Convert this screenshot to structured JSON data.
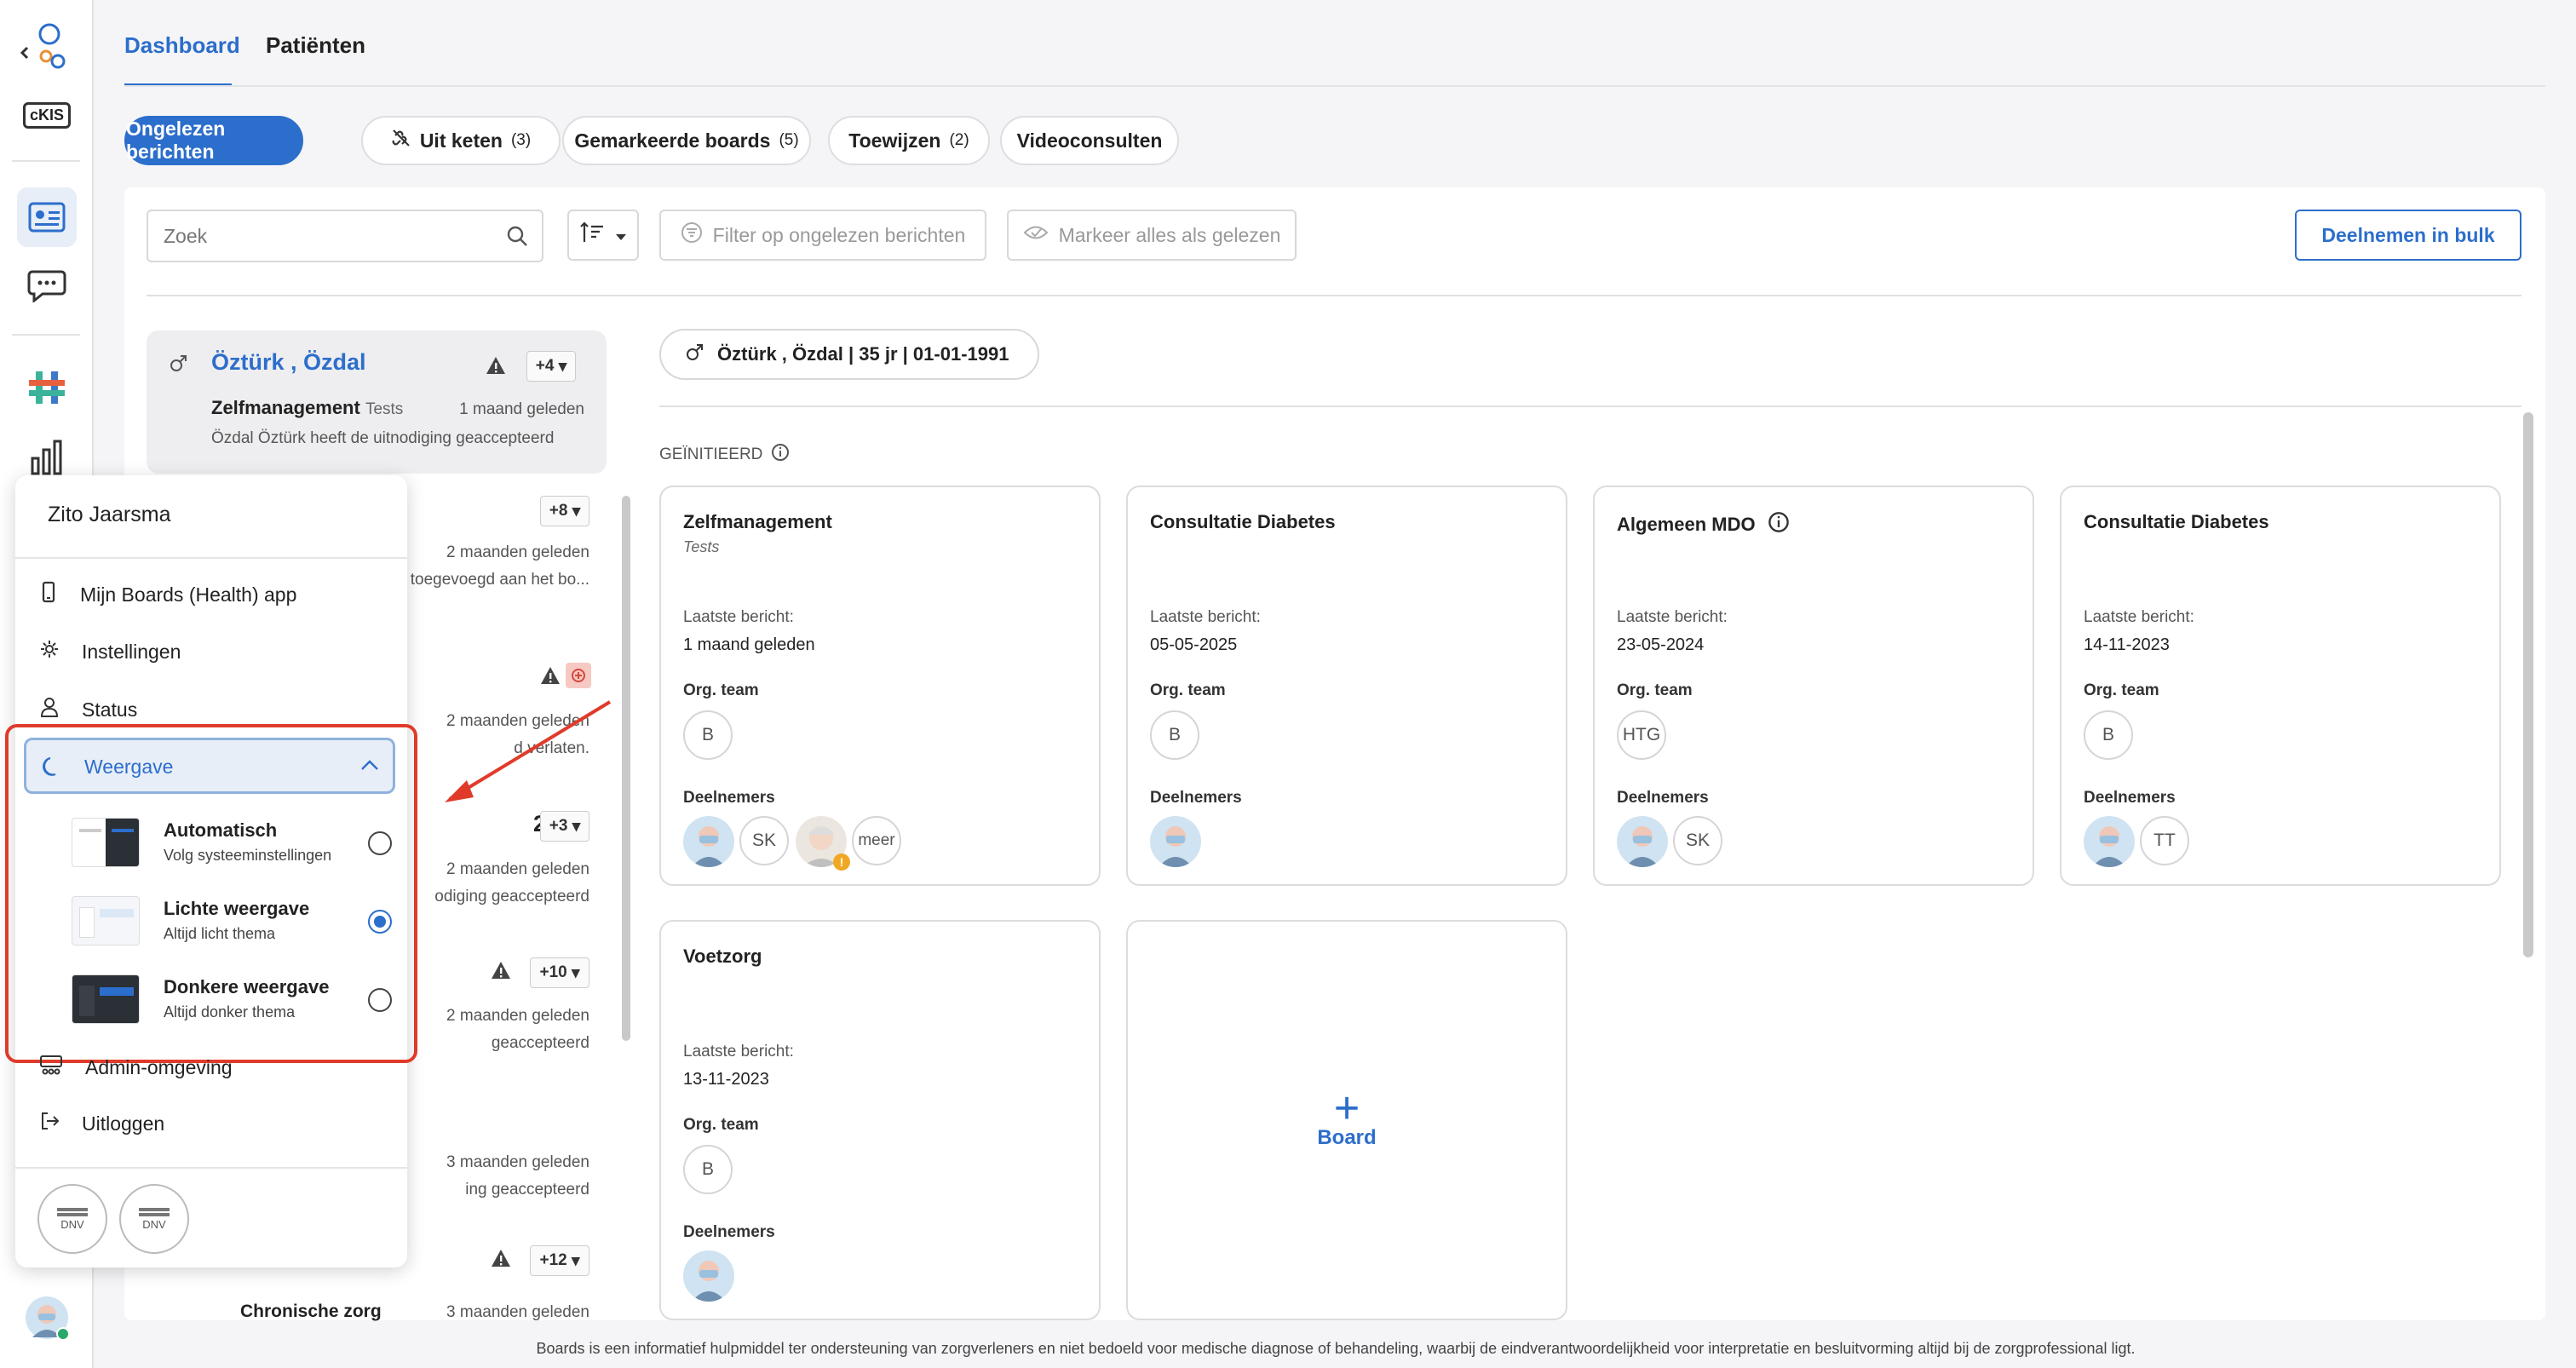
{
  "tabs": {
    "dashboard": "Dashboard",
    "patients": "Patiënten"
  },
  "rail": {
    "ckis_label": "cKIS"
  },
  "chips": [
    {
      "label": "Ongelezen berichten",
      "count": ""
    },
    {
      "label": "Uit keten",
      "count": "(3)"
    },
    {
      "label": "Gemarkeerde boards",
      "count": "(5)"
    },
    {
      "label": "Toewijzen",
      "count": "(2)"
    },
    {
      "label": "Videoconsulten",
      "count": ""
    }
  ],
  "toolbar": {
    "search_placeholder": "Zoek",
    "filter_label": "Filter op ongelezen berichten",
    "mark_all_label": "Markeer alles als gelezen",
    "bulk_label": "Deelnemen in bulk"
  },
  "list": {
    "first": {
      "name": "Öztürk , Özdal",
      "badge": "+4",
      "board": "Zelfmanagement",
      "sub": "Tests",
      "time": "1 maand geleden",
      "message": "Özdal Öztürk heeft de uitnodiging geaccepteerd"
    },
    "partials": [
      {
        "badge": "+8",
        "time": "2 maanden geleden",
        "message": "toegevoegd aan het bo..."
      },
      {
        "time": "2 maanden geleden",
        "message": "d verlaten."
      },
      {
        "badge": "+3",
        "time": "2 maanden geleden",
        "message": "odiging geaccepteerd",
        "name_tail": "2"
      },
      {
        "badge": "+10",
        "time": "2 maanden geleden",
        "message": "geaccepteerd"
      },
      {
        "time": "3 maanden geleden",
        "message": "ing geaccepteerd"
      },
      {
        "badge": "+12",
        "time": "3 maanden geleden",
        "message": "Chronische zorg"
      }
    ]
  },
  "patient": {
    "header": "Öztürk , Özdal | 35 jr | 01-01-1991"
  },
  "section_label": "GEÏNITIEERD",
  "card_labels": {
    "last_message": "Laatste bericht:",
    "org_team": "Org. team",
    "participants": "Deelnemers"
  },
  "cards": [
    {
      "title": "Zelfmanagement",
      "subtitle": "Tests",
      "last": "1 maand geleden",
      "team": "B",
      "participants": [
        "SK"
      ],
      "more": "meer"
    },
    {
      "title": "Consultatie Diabetes",
      "subtitle": "",
      "last": "05-05-2025",
      "team": "B",
      "participants": []
    },
    {
      "title": "Algemeen MDO",
      "subtitle": "",
      "last": "23-05-2024",
      "team": "HTG",
      "participants": [
        "SK"
      ]
    },
    {
      "title": "Consultatie Diabetes",
      "subtitle": "",
      "last": "14-11-2023",
      "team": "B",
      "participants": [
        "TT"
      ]
    },
    {
      "title": "Voetzorg",
      "subtitle": "",
      "last": "13-11-2023",
      "team": "B",
      "participants": []
    }
  ],
  "add_board": {
    "plus": "+",
    "label": "Board"
  },
  "menu": {
    "user": "Zito Jaarsma",
    "items": {
      "app": "Mijn Boards (Health) app",
      "settings": "Instellingen",
      "status": "Status",
      "appearance": "Weergave",
      "admin": "Admin-omgeving",
      "logout": "Uitloggen"
    },
    "options": [
      {
        "title": "Automatisch",
        "sub": "Volg systeeminstellingen",
        "selected": false
      },
      {
        "title": "Lichte weergave",
        "sub": "Altijd licht thema",
        "selected": true
      },
      {
        "title": "Donkere weergave",
        "sub": "Altijd donker thema",
        "selected": false
      }
    ],
    "cert_text": "DNV"
  },
  "footer": "Boards is een informatief hulpmiddel ter ondersteuning van zorgverleners en niet bedoeld voor medische diagnose of behandeling, waarbij de eindverantwoordelijkheid voor interpretatie en besluitvorming altijd bij de zorgprofessional ligt.",
  "colors": {
    "accent": "#2c6ecb",
    "highlight": "#e03b2a",
    "selected_row": "#eeeef0"
  }
}
